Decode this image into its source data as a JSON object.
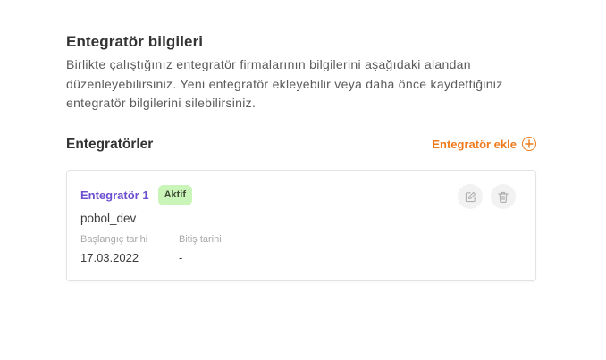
{
  "section": {
    "title": "Entegratör bilgileri",
    "description": "Birlikte çalıştığınız entegratör firmalarının bilgilerini aşağıdaki alandan düzenleyebilirsiniz. Yeni entegratör ekleyebilir veya daha önce kaydettiğiniz entegratör bilgilerini silebilirsiniz."
  },
  "list": {
    "title": "Entegratörler",
    "add_label": "Entegratör ekle"
  },
  "integrators": [
    {
      "name": "Entegratör 1",
      "status": "Aktif",
      "username": "pobol_dev",
      "start_label": "Başlangıç tarihi",
      "start_value": "17.03.2022",
      "end_label": "Bitiş tarihi",
      "end_value": "-"
    }
  ],
  "colors": {
    "accent_orange": "#ee7a1c",
    "name_purple": "#6b4fd0",
    "badge_green": "#c9f5b8"
  },
  "icons": {
    "add": "plus-circle-icon",
    "edit": "edit-icon",
    "delete": "trash-icon"
  }
}
